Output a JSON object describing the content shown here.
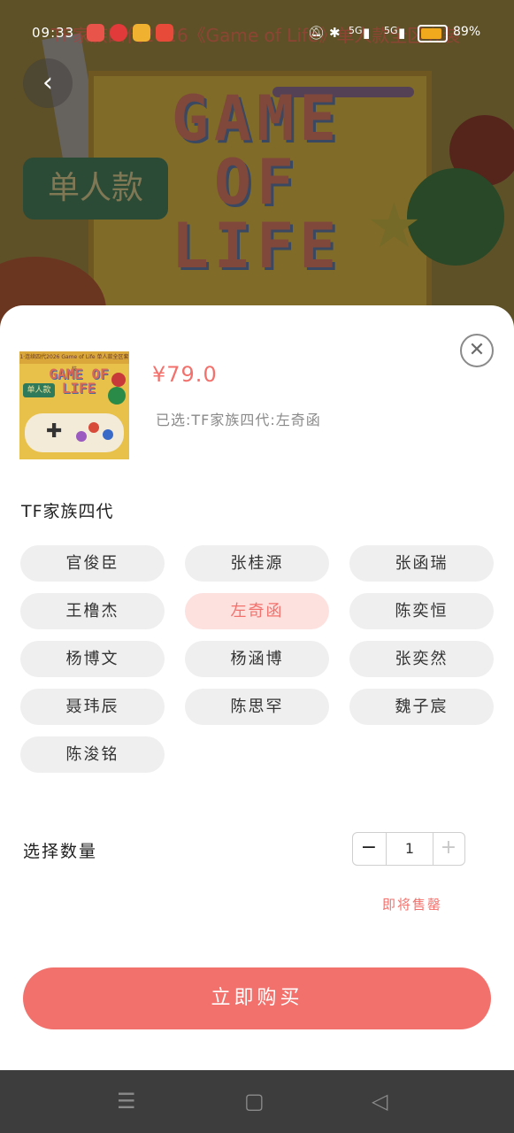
{
  "status_bar": {
    "time": "09:33",
    "notification_text": "TF家族四代2026《Game of Life》单人款全区套装",
    "network": [
      "5G",
      "5G"
    ],
    "battery": "89%"
  },
  "background": {
    "poster_title": "GAME OF LIFE",
    "poster_tag": "单人款"
  },
  "product": {
    "thumb_header": "1·连续四代2026 Game of Life 单人款全区套装",
    "thumb_title": "GAME OF LIFE",
    "thumb_tag": "单人款",
    "price": "¥79.0",
    "selected_text": "已选:TF家族四代:左奇函"
  },
  "variant_group": {
    "title": "TF家族四代",
    "options": [
      "官俊臣",
      "张桂源",
      "张函瑞",
      "王橹杰",
      "左奇函",
      "陈奕恒",
      "杨博文",
      "杨涵博",
      "张奕然",
      "聂玮辰",
      "陈思罕",
      "魏子宸",
      "陈浚铭"
    ],
    "selected": "左奇函"
  },
  "quantity": {
    "label": "选择数量",
    "value": "1",
    "minus": "−",
    "plus": "+"
  },
  "presale_text": "即将售罄",
  "buy_button": "立即购买",
  "colors": {
    "accent": "#f2716c",
    "chip_bg": "#efefef",
    "chip_active_bg": "#fde1df",
    "nav_bar": "#3d3d3d"
  }
}
